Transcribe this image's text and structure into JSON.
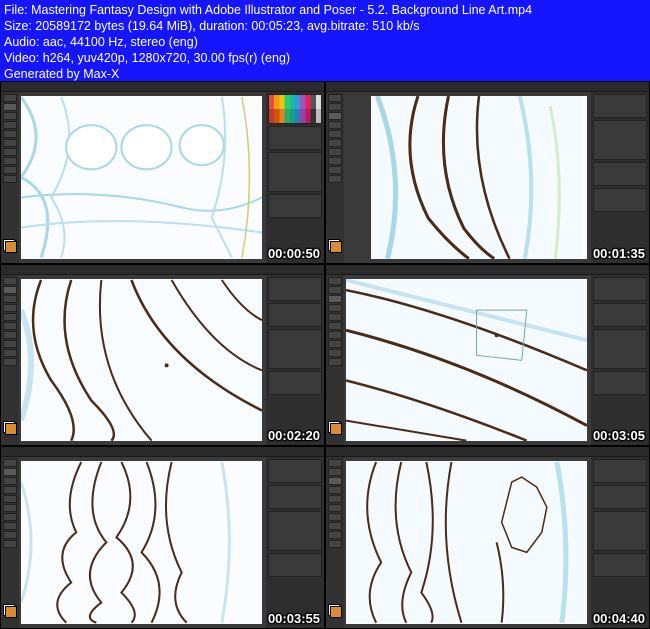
{
  "header": {
    "file_line": "File: Mastering Fantasy Design with Adobe Illustrator and Poser - 5.2. Background Line Art.mp4",
    "size_line": "Size: 20589172 bytes (19.64 MiB), duration: 00:05:23, avg.bitrate: 510 kb/s",
    "audio_line": "Audio: aac, 44100 Hz, stereo (eng)",
    "video_line": "Video: h264, yuv420p, 1280x720, 30.00 fps(r) (eng)",
    "gen_line": "Generated by Max-X"
  },
  "thumbs": [
    {
      "ts": "00:00:50"
    },
    {
      "ts": "00:01:35"
    },
    {
      "ts": "00:02:20"
    },
    {
      "ts": "00:03:05"
    },
    {
      "ts": "00:03:55"
    },
    {
      "ts": "00:04:40"
    }
  ]
}
